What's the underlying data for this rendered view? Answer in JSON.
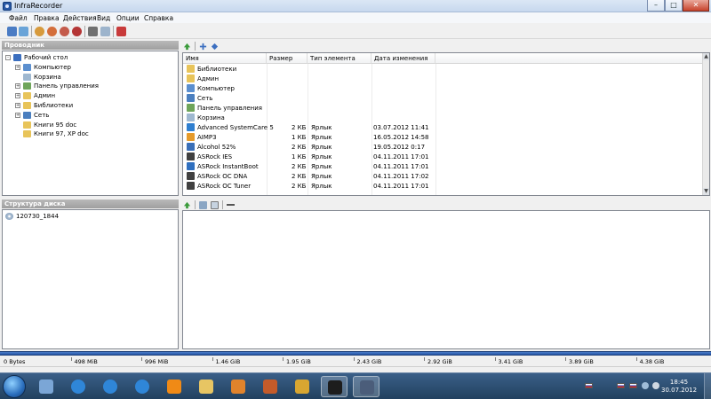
{
  "window": {
    "title": "InfraRecorder"
  },
  "menu": [
    "Файл",
    "Правка",
    "Действия",
    "Вид",
    "Опции",
    "Справка"
  ],
  "explorer": {
    "header": "Проводник",
    "tree": [
      {
        "label": "Рабочий стол",
        "level": 0,
        "expander": "-"
      },
      {
        "label": "Компьютер",
        "level": 1,
        "expander": "+"
      },
      {
        "label": "Корзина",
        "level": 1,
        "expander": ""
      },
      {
        "label": "Панель управления",
        "level": 1,
        "expander": "+"
      },
      {
        "label": "Админ",
        "level": 1,
        "expander": "+"
      },
      {
        "label": "Библиотеки",
        "level": 1,
        "expander": "+"
      },
      {
        "label": "Сеть",
        "level": 1,
        "expander": "+"
      },
      {
        "label": "Книги 95 doc",
        "level": 1,
        "expander": ""
      },
      {
        "label": "Книги 97, XP doc",
        "level": 1,
        "expander": ""
      }
    ]
  },
  "file_list": {
    "columns": [
      "Имя",
      "Размер",
      "Тип элемента",
      "Дата изменения"
    ],
    "rows": [
      {
        "name": "Библиотеки",
        "size": "",
        "type": "",
        "date": "",
        "icon_color": "#e8c45a"
      },
      {
        "name": "Админ",
        "size": "",
        "type": "",
        "date": "",
        "icon_color": "#e8c45a"
      },
      {
        "name": "Компьютер",
        "size": "",
        "type": "",
        "date": "",
        "icon_color": "#5b8fcf"
      },
      {
        "name": "Сеть",
        "size": "",
        "type": "",
        "date": "",
        "icon_color": "#4b7fbf"
      },
      {
        "name": "Панель управления",
        "size": "",
        "type": "",
        "date": "",
        "icon_color": "#6fa55a"
      },
      {
        "name": "Корзина",
        "size": "",
        "type": "",
        "date": "",
        "icon_color": "#9fb8d0"
      },
      {
        "name": "Advanced SystemCare 5",
        "size": "2 КБ",
        "type": "Ярлык",
        "date": "03.07.2012 11:41",
        "icon_color": "#2f7fd0"
      },
      {
        "name": "AIMP3",
        "size": "1 КБ",
        "type": "Ярлык",
        "date": "16.05.2012 14:58",
        "icon_color": "#e59a2a"
      },
      {
        "name": "Alcohol 52%",
        "size": "2 КБ",
        "type": "Ярлык",
        "date": "19.05.2012 0:17",
        "icon_color": "#3a6fb8"
      },
      {
        "name": "ASRock IES",
        "size": "1 КБ",
        "type": "Ярлык",
        "date": "04.11.2011 17:01",
        "icon_color": "#404040"
      },
      {
        "name": "ASRock InstantBoot",
        "size": "2 КБ",
        "type": "Ярлык",
        "date": "04.11.2011 17:01",
        "icon_color": "#2f6fbf"
      },
      {
        "name": "ASRock OC DNA",
        "size": "2 КБ",
        "type": "Ярлык",
        "date": "04.11.2011 17:02",
        "icon_color": "#404040"
      },
      {
        "name": "ASRock OC Tuner",
        "size": "2 КБ",
        "type": "Ярлык",
        "date": "04.11.2011 17:01",
        "icon_color": "#404040"
      }
    ]
  },
  "disc": {
    "header": "Структура диска",
    "root_label": "120730_1844"
  },
  "space_scale": [
    "0 Bytes",
    "498 MiB",
    "996 MiB",
    "1.46 GiB",
    "1.95 GiB",
    "2.43 GiB",
    "2.92 GiB",
    "3.41 GiB",
    "3.89 GiB",
    "4.38 GiB"
  ],
  "taskbar": {
    "time": "18:45",
    "date": "30.07.2012",
    "icon_names": [
      "book-icon",
      "internet-explorer-icon",
      "internet-explorer-icon",
      "internet-explorer-icon",
      "odnoklassniki-icon",
      "folder-icon",
      "media-player-icon",
      "guitar-icon",
      "joystick-icon",
      "asrock-icon",
      "infrarecorder-icon"
    ],
    "colors": {
      "accent": "#2556a8"
    }
  }
}
